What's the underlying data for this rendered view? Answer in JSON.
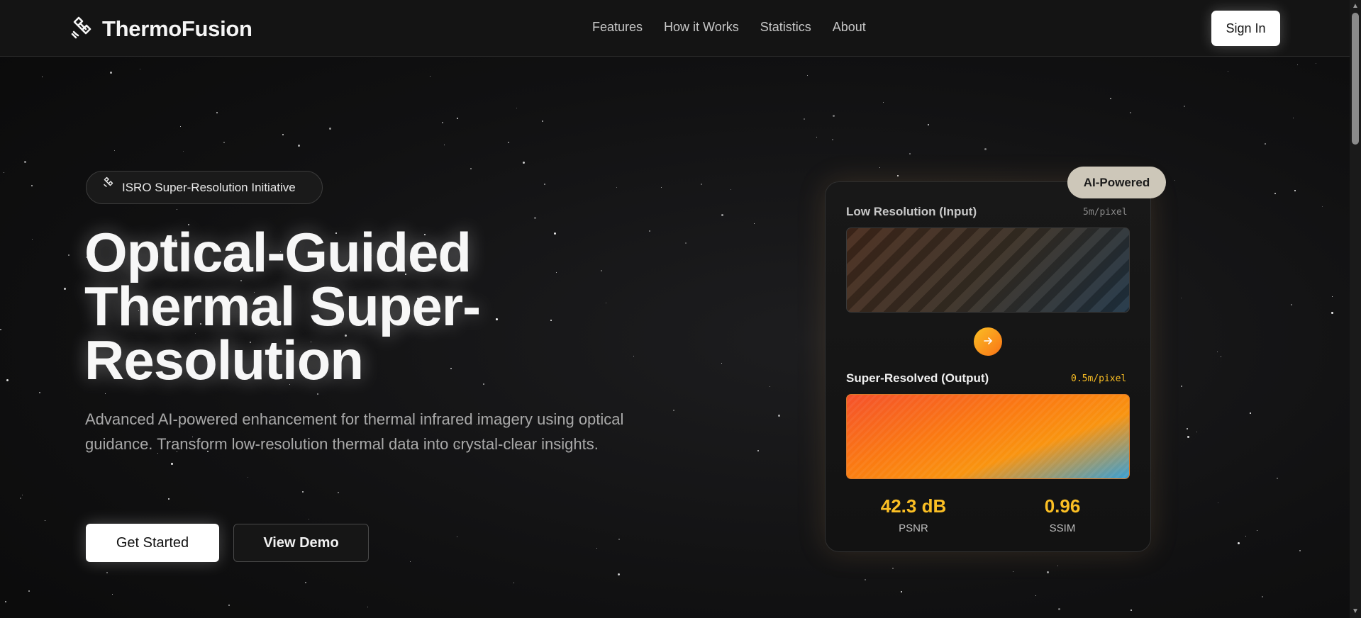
{
  "header": {
    "brand": "ThermoFusion",
    "nav": [
      "Features",
      "How it Works",
      "Statistics",
      "About"
    ],
    "sign_in": "Sign In"
  },
  "hero": {
    "badge": "ISRO Super-Resolution Initiative",
    "title_lines": [
      "Optical-Guided",
      "Thermal Super-",
      "Resolution"
    ],
    "subtitle": "Advanced AI-powered enhancement for thermal infrared imagery using optical guidance. Transform low-resolution thermal data into crystal-clear insights.",
    "primary_button": "Get Started",
    "secondary_button": "View Demo"
  },
  "card": {
    "pill": "AI-Powered",
    "input_label": "Low Resolution (Input)",
    "input_res": "5m/pixel",
    "output_label": "Super-Resolved (Output)",
    "output_res": "0.5m/pixel",
    "metrics": [
      {
        "value": "42.3 dB",
        "label": "PSNR"
      },
      {
        "value": "0.96",
        "label": "SSIM"
      }
    ]
  },
  "colors": {
    "accent": "#fbbf24",
    "background": "#111112",
    "header_bg": "#141414",
    "pill_bg": "#cdc7b9"
  },
  "icons": {
    "brand": "satellite-icon",
    "badge": "satellite-icon",
    "arrow": "arrow-right-icon"
  }
}
